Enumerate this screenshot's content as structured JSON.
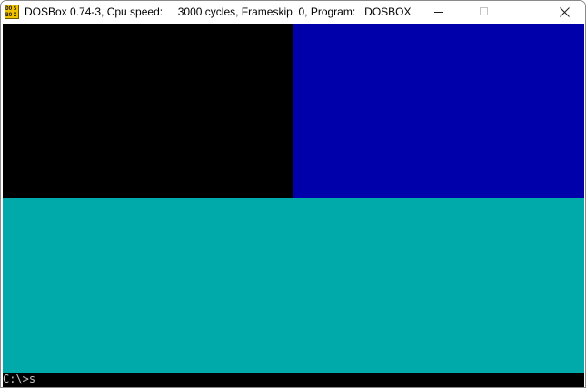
{
  "window": {
    "title": "DOSBox 0.74-3, Cpu speed:     3000 cycles, Frameskip  0, Program:   DOSBOX",
    "app_icon": {
      "name": "dosbox-icon",
      "letters": [
        "DO",
        "S",
        "BO",
        "X"
      ]
    },
    "controls": [
      "minimize",
      "maximize",
      "close"
    ]
  },
  "screen": {
    "blocks": [
      {
        "name": "black",
        "color": "#000000"
      },
      {
        "name": "blue",
        "color": "#0000aa"
      },
      {
        "name": "cyan",
        "color": "#00aaaa"
      }
    ],
    "prompt": "C:\\>s"
  }
}
